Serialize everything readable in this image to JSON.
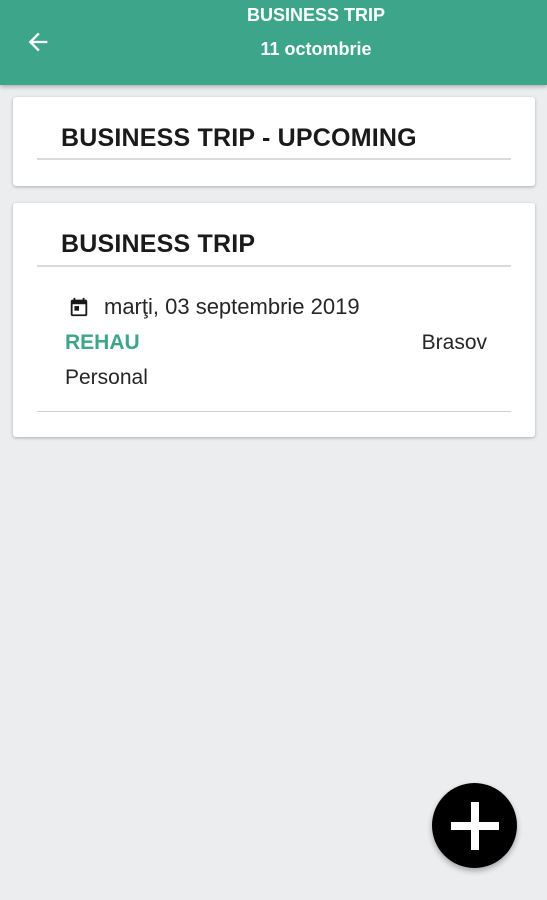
{
  "appbar": {
    "title": "BUSINESS TRIP",
    "subtitle": "11 octombrie",
    "back_icon": "arrow-back-icon",
    "color": "#3DA68A"
  },
  "upcoming_card": {
    "title": "BUSINESS TRIP - UPCOMING"
  },
  "trips_card": {
    "title": "BUSINESS TRIP",
    "items": [
      {
        "date": "marţi, 03 septembrie 2019",
        "company": "REHAU",
        "city": "Brasov",
        "type": "Personal",
        "date_icon": "calendar-icon"
      }
    ]
  },
  "fab": {
    "icon": "plus-icon",
    "color": "#000000"
  },
  "colors": {
    "accent": "#3DA68A",
    "background": "#ECEDEF"
  }
}
